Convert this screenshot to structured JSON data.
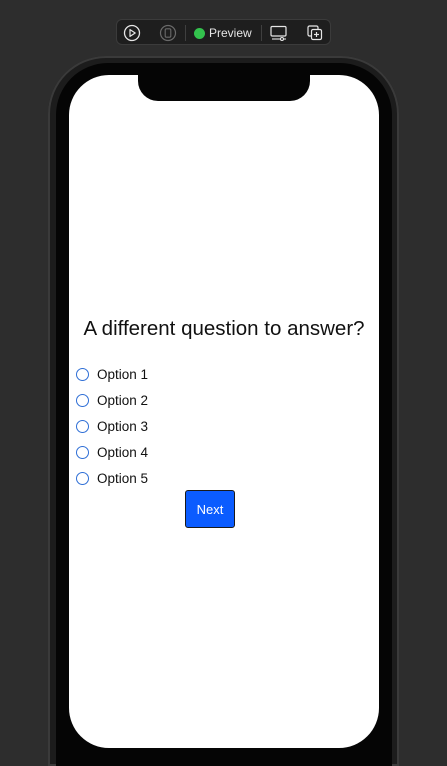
{
  "toolbar": {
    "icons": [
      "play-circle-icon",
      "device-icon",
      "monitor-settings-icon",
      "duplicate-add-icon"
    ],
    "preview_label": "Preview",
    "status_color": "#33c24d"
  },
  "quiz": {
    "question": "A different question to answer?",
    "options": [
      {
        "label": "Option 1"
      },
      {
        "label": "Option 2"
      },
      {
        "label": "Option 3"
      },
      {
        "label": "Option 4"
      },
      {
        "label": "Option 5"
      }
    ],
    "next_label": "Next"
  },
  "colors": {
    "accent": "#0b5cff",
    "radio_border": "#2f6fd6",
    "background": "#2d2d2d"
  }
}
